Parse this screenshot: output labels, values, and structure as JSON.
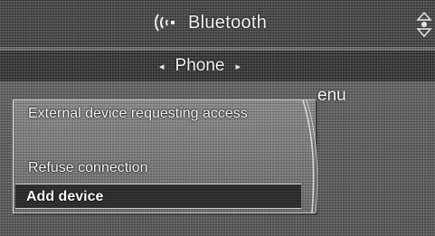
{
  "header": {
    "title": "Bluetooth",
    "icons": {
      "bluetooth": "bluetooth-signal-icon",
      "scroll": "scroll-arrows-icon"
    }
  },
  "subheader": {
    "label": "Phone",
    "prev_arrow": "◂",
    "next_arrow": "▸"
  },
  "background": {
    "line_visible_end": "enu"
  },
  "dialog": {
    "message": "External device requesting access",
    "options": [
      {
        "label": "Refuse connection",
        "selected": false
      },
      {
        "label": "Add device",
        "selected": true
      }
    ]
  },
  "colors": {
    "bar": "#4f4f4f",
    "subbar": "#3e3e3e",
    "highlight": "#2a2a2a",
    "text": "#f2f2f2"
  }
}
